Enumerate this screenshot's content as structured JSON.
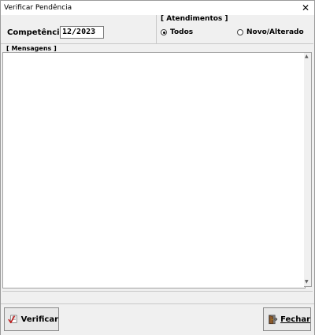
{
  "window": {
    "title": "Verificar Pendência",
    "close_glyph": "✕"
  },
  "competencia": {
    "label": "Competência:",
    "value": "12/2023"
  },
  "atendimentos": {
    "legend": "[ Atendimentos ]",
    "options": [
      {
        "label": "Todos",
        "checked": true
      },
      {
        "label": "Novo/Alterado",
        "checked": false
      }
    ]
  },
  "mensagens": {
    "legend": "[ Mensagens ]",
    "content": ""
  },
  "buttons": {
    "verificar": {
      "label": "Verificar",
      "icon": "check-document-icon"
    },
    "fechar": {
      "label": "Fechar",
      "icon": "door-exit-icon"
    }
  },
  "colors": {
    "window_bg": "#f0f0f0",
    "field_bg": "#ffffff",
    "check_red": "#c01818",
    "door_brown": "#8b5a2b"
  }
}
